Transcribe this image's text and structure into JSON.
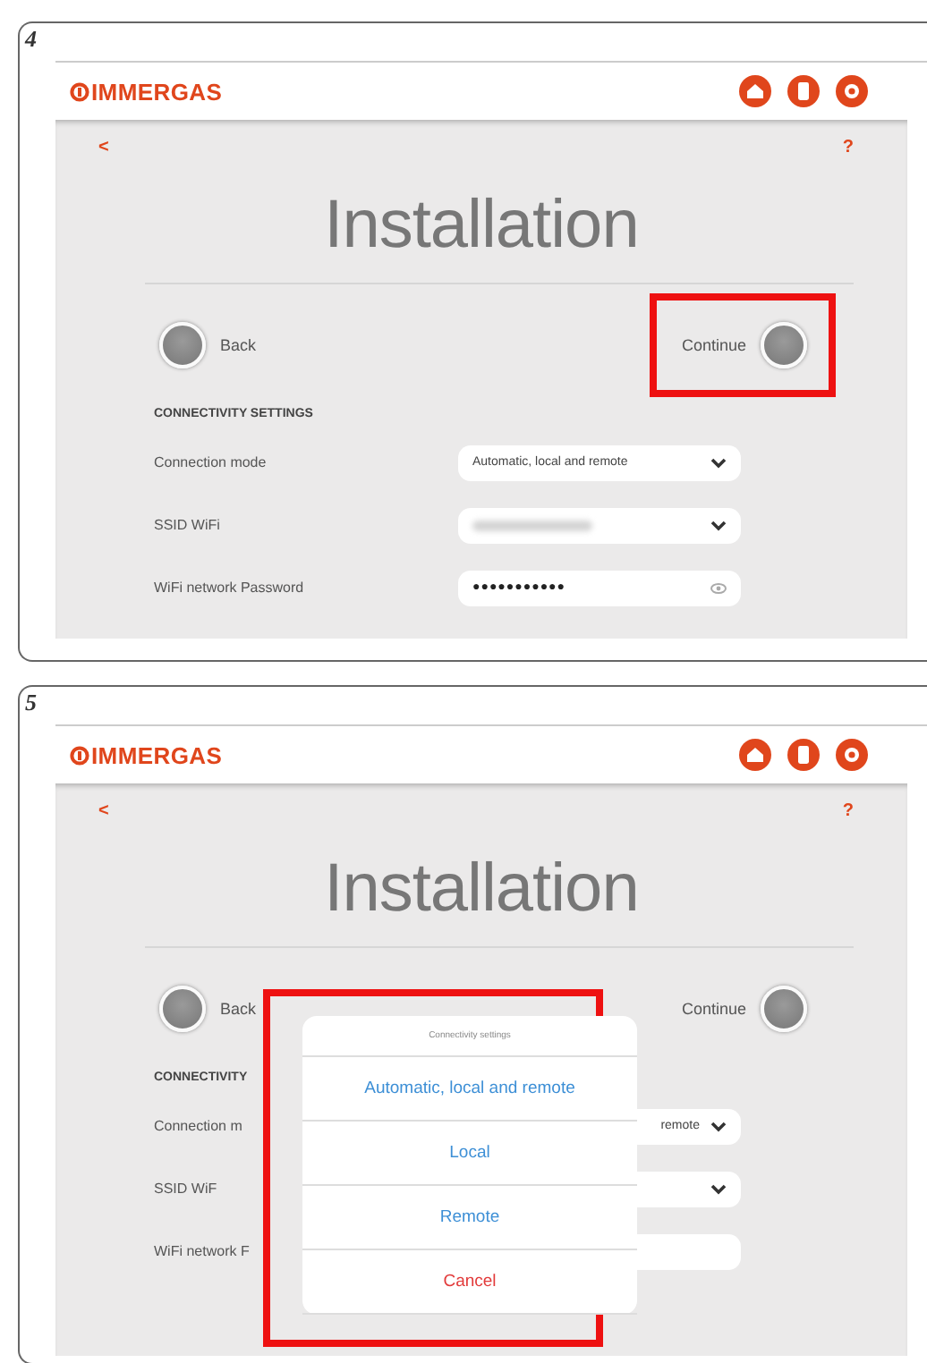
{
  "steps": [
    {
      "number": "4",
      "brand": "IMMERGAS",
      "back_arrow": "<",
      "help": "?",
      "title": "Installation",
      "back": {
        "label": "Back"
      },
      "continue": {
        "label": "Continue",
        "highlighted": true
      },
      "section": "CONNECTIVITY SETTINGS",
      "rows": [
        {
          "label": "Connection mode",
          "kind": "select",
          "value": "Automatic, local and remote",
          "cut": false
        },
        {
          "label": "SSID WiFi",
          "kind": "select",
          "blurred": true
        },
        {
          "label": "WiFi network Password",
          "kind": "password",
          "value": "●●●●●●●●●●●"
        }
      ]
    },
    {
      "number": "5",
      "brand": "IMMERGAS",
      "back_arrow": "<",
      "help": "?",
      "title": "Installation",
      "back": {
        "label": "Back"
      },
      "continue": {
        "label": "Continue",
        "highlighted": false
      },
      "section": "CONNECTIVITY",
      "rows": [
        {
          "label": "Connection m",
          "kind": "select",
          "value": "remote",
          "cut": true
        },
        {
          "label": "SSID WiF",
          "kind": "select"
        },
        {
          "label": "WiFi network F",
          "kind": "password"
        }
      ],
      "sheet": {
        "title": "Connectivity settings",
        "items": [
          {
            "label": "Automatic, local and remote",
            "kind": "option"
          },
          {
            "label": "Local",
            "kind": "option"
          },
          {
            "label": "Remote",
            "kind": "option"
          },
          {
            "label": "Cancel",
            "kind": "cancel"
          }
        ]
      }
    }
  ]
}
